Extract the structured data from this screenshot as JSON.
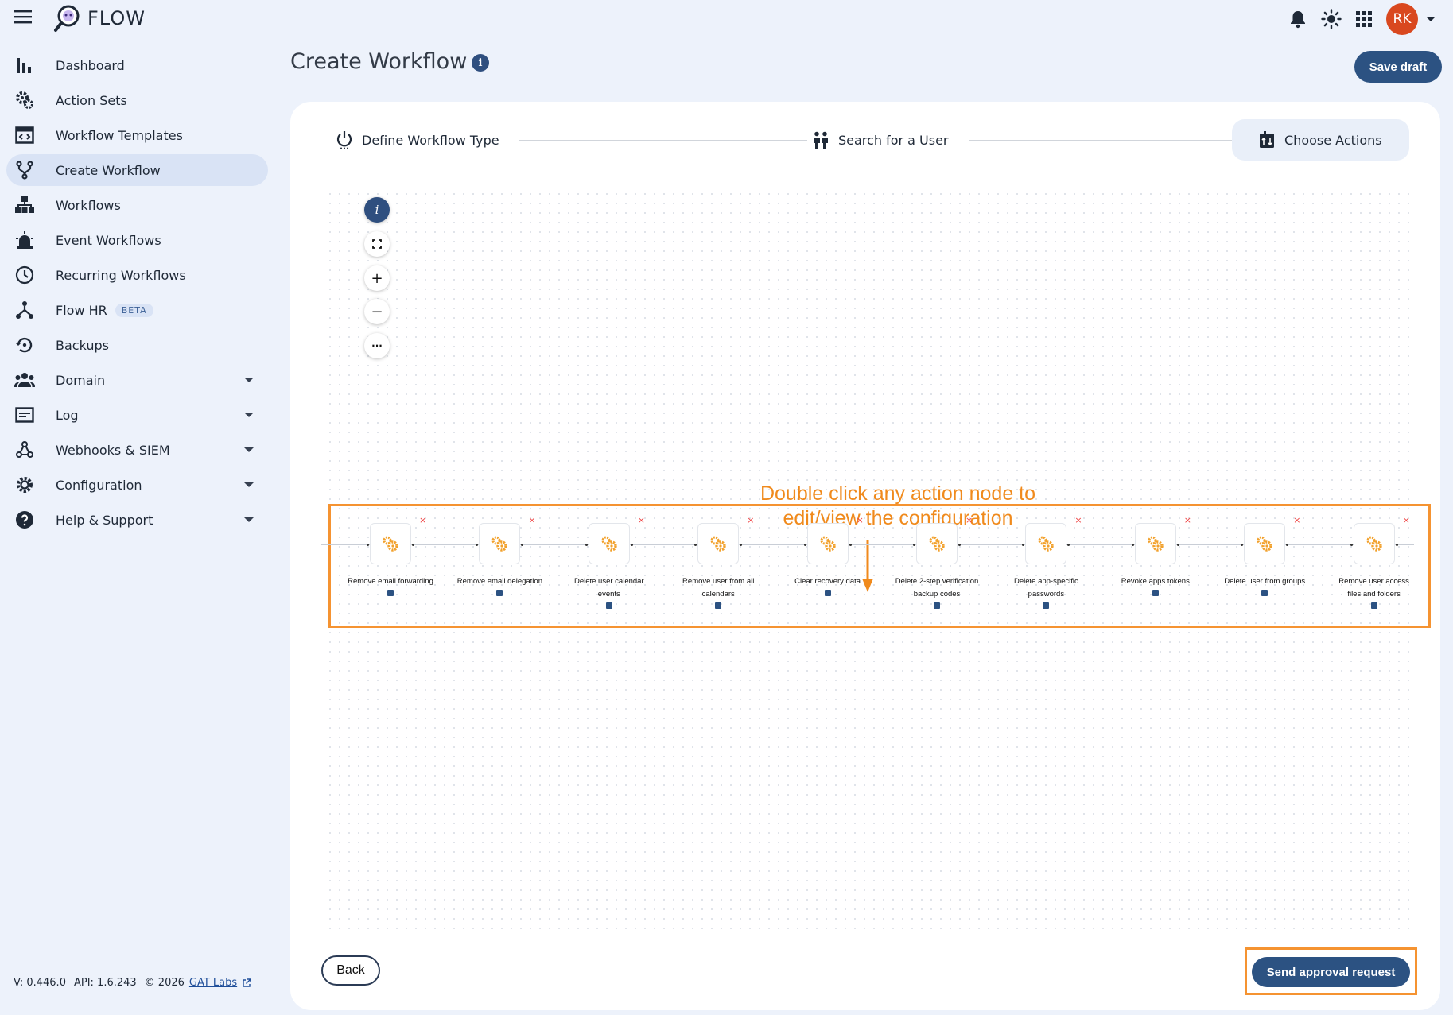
{
  "app": {
    "name": "FLOW",
    "user_initials": "RK"
  },
  "sidebar": {
    "items": [
      {
        "label": "Dashboard",
        "icon": "bar-chart-icon"
      },
      {
        "label": "Action Sets",
        "icon": "gears-icon"
      },
      {
        "label": "Workflow Templates",
        "icon": "template-icon"
      },
      {
        "label": "Create Workflow",
        "icon": "branch-icon",
        "active": true
      },
      {
        "label": "Workflows",
        "icon": "hierarchy-icon"
      },
      {
        "label": "Event Workflows",
        "icon": "alarm-icon"
      },
      {
        "label": "Recurring Workflows",
        "icon": "clock-icon"
      },
      {
        "label": "Flow HR",
        "icon": "hr-icon",
        "badge": "BETA"
      },
      {
        "label": "Backups",
        "icon": "backup-icon"
      },
      {
        "label": "Domain",
        "icon": "people-icon",
        "expandable": true
      },
      {
        "label": "Log",
        "icon": "log-icon",
        "expandable": true
      },
      {
        "label": "Webhooks & SIEM",
        "icon": "webhook-icon",
        "expandable": true
      },
      {
        "label": "Configuration",
        "icon": "gear-icon",
        "expandable": true
      },
      {
        "label": "Help & Support",
        "icon": "help-icon",
        "expandable": true
      }
    ],
    "footer": {
      "version": "V: 0.446.0",
      "api": "API: 1.6.243",
      "copyright": "© 2026",
      "company_link": "GAT Labs"
    }
  },
  "header": {
    "title": "Create Workflow",
    "save_draft": "Save draft"
  },
  "stepper": {
    "steps": [
      {
        "label": "Define Workflow Type"
      },
      {
        "label": "Search for a User"
      },
      {
        "label": "Choose Actions",
        "active": true
      }
    ]
  },
  "canvas": {
    "controls": [
      "i",
      "+",
      "−",
      "···"
    ],
    "hint_line1": "Double click any action node to",
    "hint_line2": "edit/view the configuration",
    "nodes": [
      {
        "line1": "Remove email forwarding",
        "line2": ""
      },
      {
        "line1": "Remove email delegation",
        "line2": ""
      },
      {
        "line1": "Delete user calendar",
        "line2": "events"
      },
      {
        "line1": "Remove user from all",
        "line2": "calendars"
      },
      {
        "line1": "Clear recovery data",
        "line2": ""
      },
      {
        "line1": "Delete 2-step verification",
        "line2": "backup codes"
      },
      {
        "line1": "Delete app-specific",
        "line2": "passwords"
      },
      {
        "line1": "Revoke apps tokens",
        "line2": ""
      },
      {
        "line1": "Delete user from groups",
        "line2": ""
      },
      {
        "line1": "Remove user access",
        "line2": "files and folders"
      }
    ],
    "node_delete": "×"
  },
  "actions": {
    "back": "Back",
    "send": "Send approval request"
  },
  "colors": {
    "primary": "#2c5282",
    "highlight": "#f59331",
    "hint_text": "#f08a1c",
    "avatar": "#d9481f"
  }
}
